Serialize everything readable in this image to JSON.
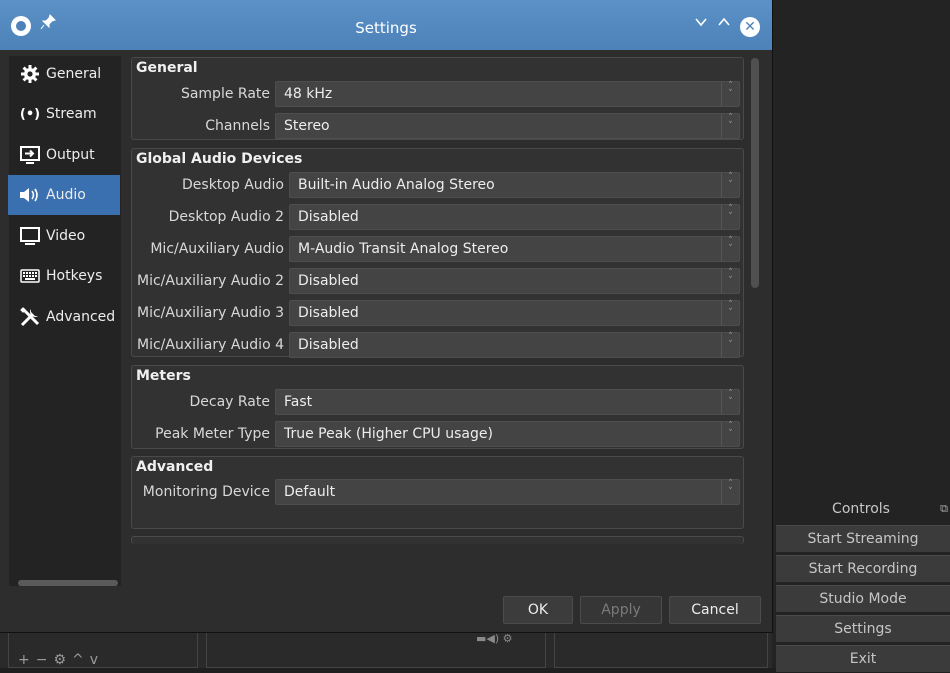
{
  "window": {
    "title": "Settings"
  },
  "sidebar": {
    "items": [
      {
        "label": "General",
        "icon": "gear-icon"
      },
      {
        "label": "Stream",
        "icon": "antenna-icon"
      },
      {
        "label": "Output",
        "icon": "output-icon"
      },
      {
        "label": "Audio",
        "icon": "speaker-icon",
        "active": true
      },
      {
        "label": "Video",
        "icon": "monitor-icon"
      },
      {
        "label": "Hotkeys",
        "icon": "keyboard-icon"
      },
      {
        "label": "Advanced",
        "icon": "tools-icon"
      }
    ]
  },
  "groups": {
    "general": {
      "title": "General",
      "sample_rate": {
        "label": "Sample Rate",
        "value": "48 kHz"
      },
      "channels": {
        "label": "Channels",
        "value": "Stereo"
      }
    },
    "devices": {
      "title": "Global Audio Devices",
      "rows": [
        {
          "label": "Desktop Audio",
          "value": "Built-in Audio Analog Stereo"
        },
        {
          "label": "Desktop Audio 2",
          "value": "Disabled"
        },
        {
          "label": "Mic/Auxiliary Audio",
          "value": "M-Audio Transit Analog Stereo"
        },
        {
          "label": "Mic/Auxiliary Audio 2",
          "value": "Disabled"
        },
        {
          "label": "Mic/Auxiliary Audio 3",
          "value": "Disabled"
        },
        {
          "label": "Mic/Auxiliary Audio 4",
          "value": "Disabled"
        }
      ]
    },
    "meters": {
      "title": "Meters",
      "decay_rate": {
        "label": "Decay Rate",
        "value": "Fast"
      },
      "peak_meter_type": {
        "label": "Peak Meter Type",
        "value": "True Peak (Higher CPU usage)"
      }
    },
    "advanced": {
      "title": "Advanced",
      "monitoring_device": {
        "label": "Monitoring Device",
        "value": "Default"
      }
    }
  },
  "buttons": {
    "ok": "OK",
    "apply": "Apply",
    "cancel": "Cancel"
  },
  "background": {
    "controls_title": "Controls",
    "controls": [
      "Start Streaming",
      "Start Recording",
      "Studio Mode",
      "Settings",
      "Exit"
    ]
  },
  "colors": {
    "accent": "#3a6fb0",
    "titlebar": "#4d82b8",
    "background": "#2d2d2d"
  }
}
